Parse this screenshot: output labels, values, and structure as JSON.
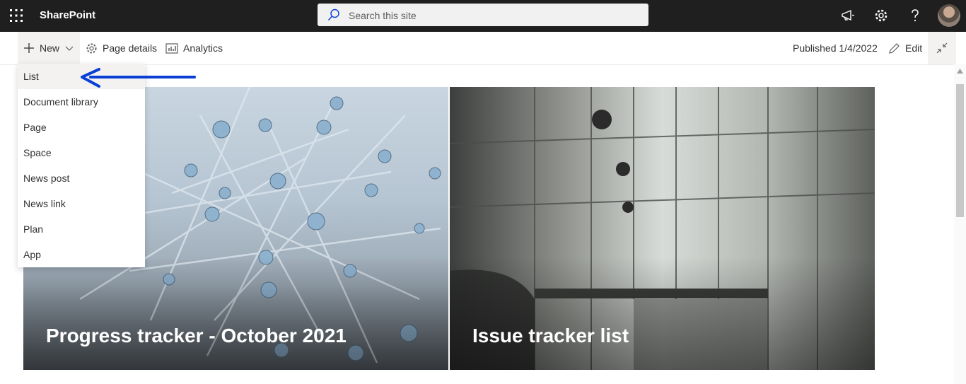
{
  "app": {
    "title": "SharePoint"
  },
  "search": {
    "placeholder": "Search this site"
  },
  "commandbar": {
    "new_label": "New",
    "page_details_label": "Page details",
    "analytics_label": "Analytics",
    "published_label": "Published 1/4/2022",
    "edit_label": "Edit"
  },
  "new_menu": {
    "items": [
      {
        "label": "List"
      },
      {
        "label": "Document library"
      },
      {
        "label": "Page"
      },
      {
        "label": "Space"
      },
      {
        "label": "News post"
      },
      {
        "label": "News link"
      },
      {
        "label": "Plan"
      },
      {
        "label": "App"
      }
    ]
  },
  "tiles": [
    {
      "title": "Progress tracker - October 2021"
    },
    {
      "title": "Issue tracker list"
    }
  ],
  "colors": {
    "topbar": "#1f1f1f",
    "accent_arrow": "#0a3fd6"
  },
  "icons": {
    "waffle": "app-launcher-icon",
    "megaphone": "megaphone-icon",
    "settings": "gear-icon",
    "help": "help-icon"
  }
}
